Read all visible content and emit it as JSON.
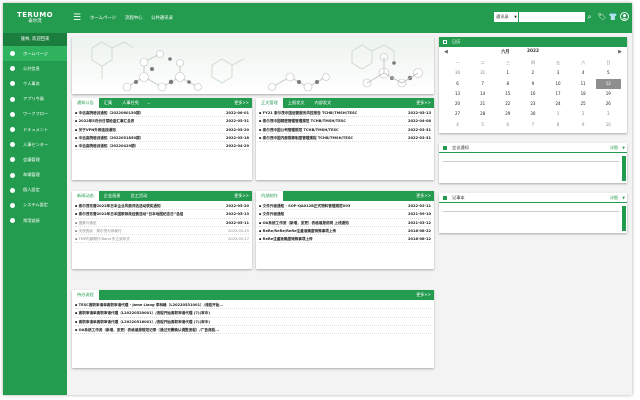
{
  "brand": {
    "name": "TERUMO",
    "sub": "泰尔茂"
  },
  "user": {
    "name": "施林, 欢迎回来"
  },
  "sidebar": {
    "items": [
      {
        "label": "ホームページ",
        "icon": "home-icon"
      },
      {
        "label": "公共信息",
        "icon": "globe-icon"
      },
      {
        "label": "个人事务",
        "icon": "person-icon"
      },
      {
        "label": "アプリ今風",
        "icon": "app-icon"
      },
      {
        "label": "ワークフロー",
        "icon": "workflow-icon"
      },
      {
        "label": "ドキュメント",
        "icon": "document-icon"
      },
      {
        "label": "人事センター",
        "icon": "people-icon"
      },
      {
        "label": "会議管理",
        "icon": "meeting-icon"
      },
      {
        "label": "车辆管理",
        "icon": "car-icon"
      },
      {
        "label": "個人設定",
        "icon": "user-settings-icon"
      },
      {
        "label": "システム設定",
        "icon": "gear-icon"
      },
      {
        "label": "常用链接",
        "icon": "link-icon"
      }
    ]
  },
  "topnav": {
    "items": [
      "ホームページ",
      "流程中心",
      "公共通讯录"
    ]
  },
  "search": {
    "filter": "通讯录",
    "placeholder": ""
  },
  "panels": {
    "notice": {
      "tabs": [
        "通知公告",
        "汇集",
        "人事任免"
      ],
      "more": "更多>>",
      "rows": [
        {
          "title": "中信高院培训通知（2022060150期）",
          "date": "2022-06-01"
        },
        {
          "title": "2022年5月份日常检查汇事汇总表",
          "date": "2022-05-31"
        },
        {
          "title": "关于VPN外网连接通知",
          "date": "2022-05-20"
        },
        {
          "title": "中信高院培训通知（2022051850期）",
          "date": "2022-05-18"
        },
        {
          "title": "中信高院培训通知（20220429期）",
          "date": "2022-04-29"
        }
      ]
    },
    "process": {
      "tabs": [
        "正文管理",
        "上报发文",
        "内部发文"
      ],
      "more": "更多>>",
      "rows": [
        {
          "title": "FY21 泰尔茂中国运营服务风控报告 TCHB/TMSH/TESC",
          "date": "2022-05-13"
        },
        {
          "title": "泰尔茂中国精密管理管理规范 TCHB/TMSH/TESC",
          "date": "2022-04-08"
        },
        {
          "title": "泰尔茂中国公司管理规范 TCHB/TMSH/TESC",
          "date": "2022-03-31"
        },
        {
          "title": "泰尔茂中国内部规章制度管理规程 TCHB/TMSH/TESC",
          "date": "2022-03-31"
        }
      ]
    },
    "news": {
      "tabs": [
        "新闻动态",
        "企业画册",
        "员工活动"
      ],
      "more": "更多>>",
      "rows": [
        {
          "title": "泰尔茂东营2022年日本企业风貌评选活动获奖通知",
          "date": "2022-05-20",
          "style": "bold"
        },
        {
          "title": "泰尔茂东营2022年日本国家邮政经营活动“日本地图纪念日”总结",
          "date": "2022-05-13",
          "style": "bold"
        },
        {
          "title": "国美与索尼",
          "date": "2022-05-11",
          "style": "gray2"
        },
        {
          "title": "天然的民 · 泰尔茂与你我行",
          "date": "2022-05-25",
          "style": "gray"
        },
        {
          "title": "TMP内部期刊 Band 东立双年式",
          "date": "2022-05-17",
          "style": "gray"
        }
      ]
    },
    "internal": {
      "tabs": [
        "内部制作"
      ],
      "more": "更多>>",
      "rows": [
        {
          "title": "文件升级通知 · SOP-QA012B正式物料管理规范V03",
          "date": "2022-02-11"
        },
        {
          "title": "文件升级通知",
          "date": "2021-09-10"
        },
        {
          "title": "OA系统工作流（新增，变更）表格填报说明 上线通知",
          "date": "2021-03-12"
        },
        {
          "title": "ReRe/ReRe/ReRe注重准确度特殊事项上传",
          "date": "2018-08-22"
        },
        {
          "title": "ReRe注重准确度特殊事项上传",
          "date": "2018-08-12"
        }
      ]
    },
    "todo": {
      "tabs": [
        "待办流程"
      ],
      "more": "更多>>",
      "rows": [
        {
          "title": "TESC离职审请单离职审请代理 - Jame Liang 李林峰（L20220531001）/流程开始..."
        },
        {
          "title": "离职审请单离职审请代理（L20220520001）/流程开始离职审请代理 (7)(审中)"
        },
        {
          "title": "离职审请单离职审请代理（L20220518001）/流程开始离职审请代理 (7)(审中)"
        },
        {
          "title": "OA系统工作流（新增，变更）表格填报规范记录（通过无需确认调整流程）/广告流程..."
        }
      ]
    }
  },
  "calendar": {
    "title": "日历",
    "month": "六月",
    "year": "2022",
    "weekdays": [
      "一",
      "二",
      "三",
      "四",
      "五",
      "六",
      "日"
    ],
    "weeks": [
      [
        "30",
        "31",
        "1",
        "2",
        "3",
        "4",
        "5"
      ],
      [
        "6",
        "7",
        "8",
        "9",
        "10",
        "11",
        "12"
      ],
      [
        "13",
        "14",
        "15",
        "16",
        "17",
        "18",
        "19"
      ],
      [
        "20",
        "21",
        "22",
        "23",
        "24",
        "25",
        "26"
      ],
      [
        "27",
        "28",
        "29",
        "30",
        "1",
        "2",
        "3"
      ],
      [
        "4",
        "5",
        "6",
        "7",
        "8",
        "9",
        "10"
      ]
    ],
    "selected": "12"
  },
  "side_panels": {
    "meetings": {
      "title": "会议通知",
      "action": "详细",
      "icon": "meeting-icon"
    },
    "records": {
      "title": "记事本",
      "action": "详细",
      "icon": "notebook-icon"
    }
  },
  "colors": {
    "primary": "#249c4f",
    "sidebar_active": "#2fb35e",
    "dark_green": "#1c7e3e"
  }
}
